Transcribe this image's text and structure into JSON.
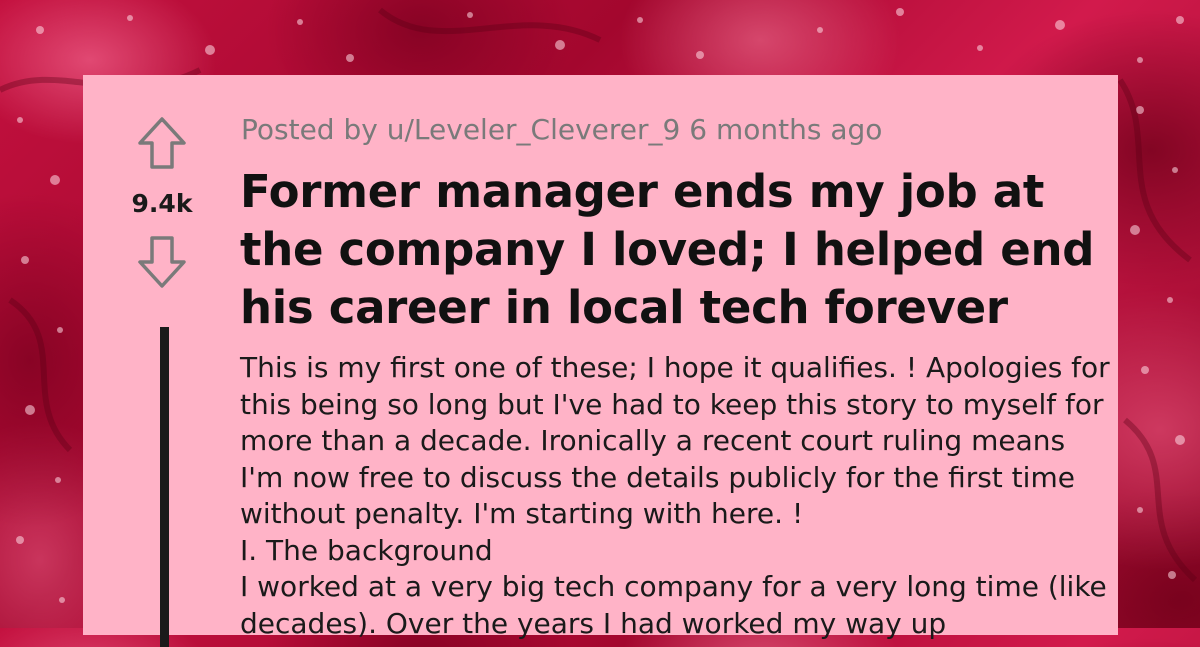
{
  "post": {
    "meta": "Posted by u/Leveler_Cleverer_9 6 months ago",
    "title": "Former manager ends my job at the company I loved; I helped end his career in local tech forever",
    "votes": "9.4k",
    "upvote_icon": "arrow-up-outline-icon",
    "downvote_icon": "arrow-down-outline-icon",
    "body": [
      "This is my first one of these; I hope it qualifies. ! Apologies for this being so long but I've had to keep this story to myself for more than a decade. Ironically a recent court ruling means I'm now free to discuss the details publicly for the first time without penalty. I'm starting with here. !",
      "I. The background",
      "I worked at a very big tech company for a very long time (like decades). Over the years I had worked my way up"
    ]
  },
  "colors": {
    "card_background": "#ffb3c7",
    "background_red": "#c4113f",
    "text": "#1a1a1a",
    "meta_text": "#7a7a7a"
  }
}
